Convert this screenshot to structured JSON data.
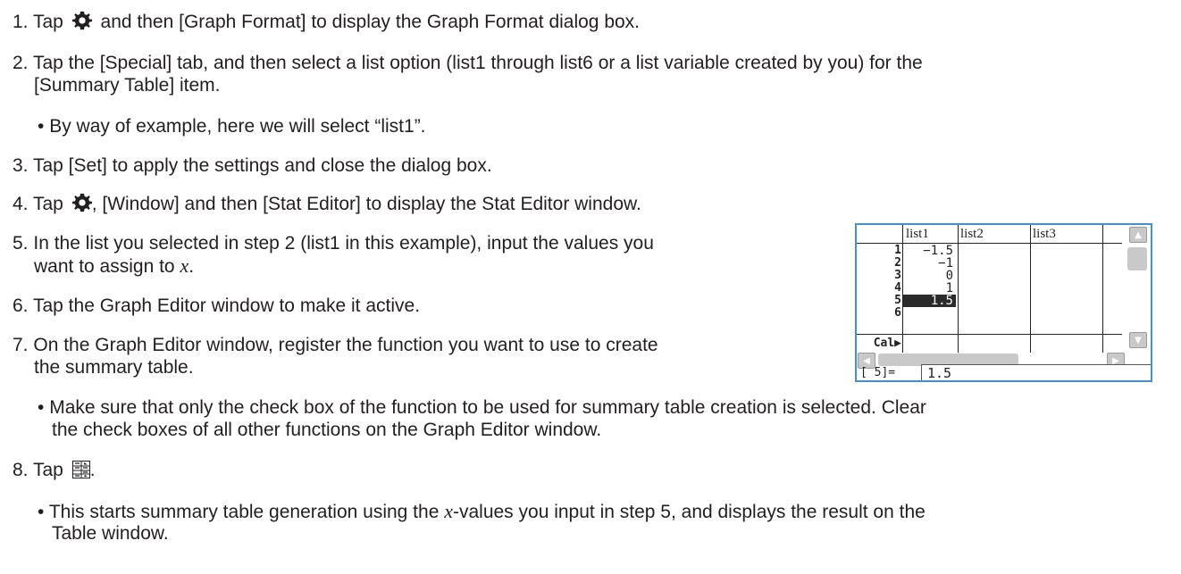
{
  "steps": {
    "s1_num": "1.",
    "s1_pre": "Tap",
    "s1_post": "and then [Graph Format] to display the Graph Format dialog box.",
    "s2_num": "2.",
    "s2_line1": "Tap the [Special] tab, and then select a list option (list1 through list6 or a list variable created by you) for the",
    "s2_line2": "[Summary Table] item.",
    "s2_bullet": "By way of example, here we will select “list1”.",
    "s3_num": "3.",
    "s3": "Tap [Set] to apply the settings and close the dialog box.",
    "s4_num": "4.",
    "s4_pre": "Tap",
    "s4_post": ", [Window] and then [Stat Editor] to display the Stat Editor window.",
    "s5_num": "5.",
    "s5_line1": "In the list you selected in step 2 (list1 in this example), input the values you",
    "s5_line2_pre": "want to assign to",
    "s5_var": "x",
    "s5_line2_post": ".",
    "s6_num": "6.",
    "s6": "Tap the Graph Editor window to make it active.",
    "s7_num": "7.",
    "s7_line1": "On the Graph Editor window, register the function you want to use to create",
    "s7_line2": "the summary table.",
    "s7_bullet_line1": "Make sure that only the check box of the function to be used for summary table creation is selected. Clear",
    "s7_bullet_line2": "the check boxes of all other functions on the Graph Editor window.",
    "s8_num": "8.",
    "s8_pre": "Tap",
    "s8_post": ".",
    "s8_bullet_pre": "This starts summary table generation using the",
    "s8_var": "x",
    "s8_bullet_post": "-values you input in step 5, and displays the result on the",
    "s8_bullet_line2": "Table window.",
    "bullet": "•"
  },
  "icons": {
    "settings": "gear-icon",
    "summary_table": "summary-table-icon"
  },
  "stat_editor": {
    "columns": [
      "list1",
      "list2",
      "list3"
    ],
    "row_numbers": [
      "1",
      "2",
      "3",
      "4",
      "5",
      "6"
    ],
    "list1_values": [
      "−1.5",
      "−1",
      "0",
      "1",
      "1.5",
      ""
    ],
    "selected_row": 5,
    "cal_label": "Cal▶",
    "entry_label": "[ 5]=",
    "entry_value": "1.5",
    "accent_color": "#4a90c8",
    "selected_cell_color": "#2b2b2b"
  }
}
